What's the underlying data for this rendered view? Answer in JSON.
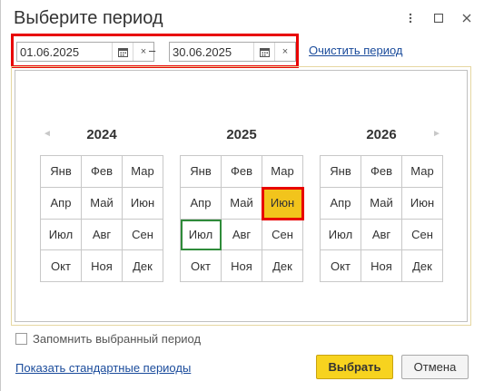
{
  "window": {
    "title": "Выберите период",
    "buttons": [
      "more-icon",
      "maximize-icon",
      "close-icon"
    ]
  },
  "period": {
    "start": "01.06.2025",
    "end": "30.06.2025",
    "separator": "–",
    "clear_button": "×",
    "calendar_icon": "calendar-icon",
    "clear_link": "Очистить период"
  },
  "calendar": {
    "nav_prev": "◄",
    "nav_next": "►",
    "years": [
      {
        "year": "2024",
        "months": [
          "Янв",
          "Фев",
          "Мар",
          "Апр",
          "Май",
          "Июн",
          "Июл",
          "Авг",
          "Сен",
          "Окт",
          "Ноя",
          "Дек"
        ]
      },
      {
        "year": "2025",
        "months": [
          "Янв",
          "Фев",
          "Мар",
          "Апр",
          "Май",
          "Июн",
          "Июл",
          "Авг",
          "Сен",
          "Окт",
          "Ноя",
          "Дек"
        ],
        "selected_month": "Июн",
        "current_month": "Июл"
      },
      {
        "year": "2026",
        "months": [
          "Янв",
          "Фев",
          "Мар",
          "Апр",
          "Май",
          "Июн",
          "Июл",
          "Авг",
          "Сен",
          "Окт",
          "Ноя",
          "Дек"
        ]
      }
    ]
  },
  "remember": {
    "label": "Запомнить выбранный период",
    "checked": false
  },
  "footer": {
    "std_periods_link": "Показать стандартные периоды",
    "ok_label": "Выбрать",
    "cancel_label": "Отмена"
  },
  "colors": {
    "highlight_red": "#e80000",
    "selected_fill": "#f2c41c",
    "current_outline": "#2f8b3a",
    "link": "#1a4b9b",
    "primary_button": "#f7d31f"
  }
}
